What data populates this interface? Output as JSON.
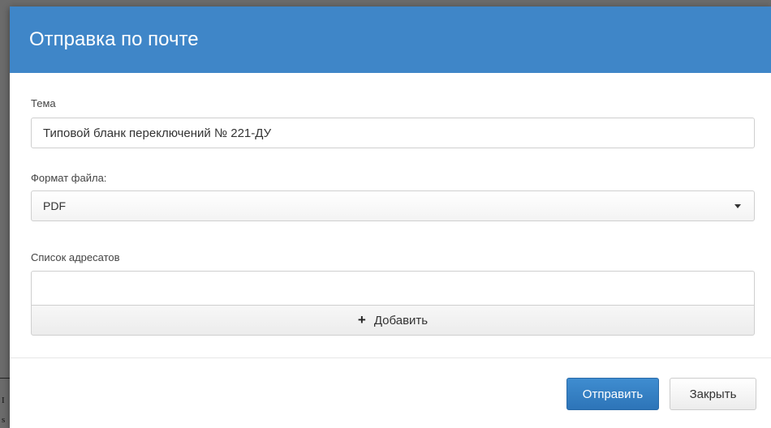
{
  "dialog": {
    "title": "Отправка по почте"
  },
  "subject": {
    "label": "Тема",
    "value": "Типовой бланк переключений № 221-ДУ"
  },
  "file_format": {
    "label": "Формат файла:",
    "selected": "PDF"
  },
  "recipients": {
    "label": "Список адресатов",
    "add_label": "Добавить",
    "add_icon": "plus-icon"
  },
  "footer": {
    "send_label": "Отправить",
    "close_label": "Закрыть"
  },
  "colors": {
    "header_bg": "#3f86c8",
    "primary_button": "#337ab7"
  }
}
